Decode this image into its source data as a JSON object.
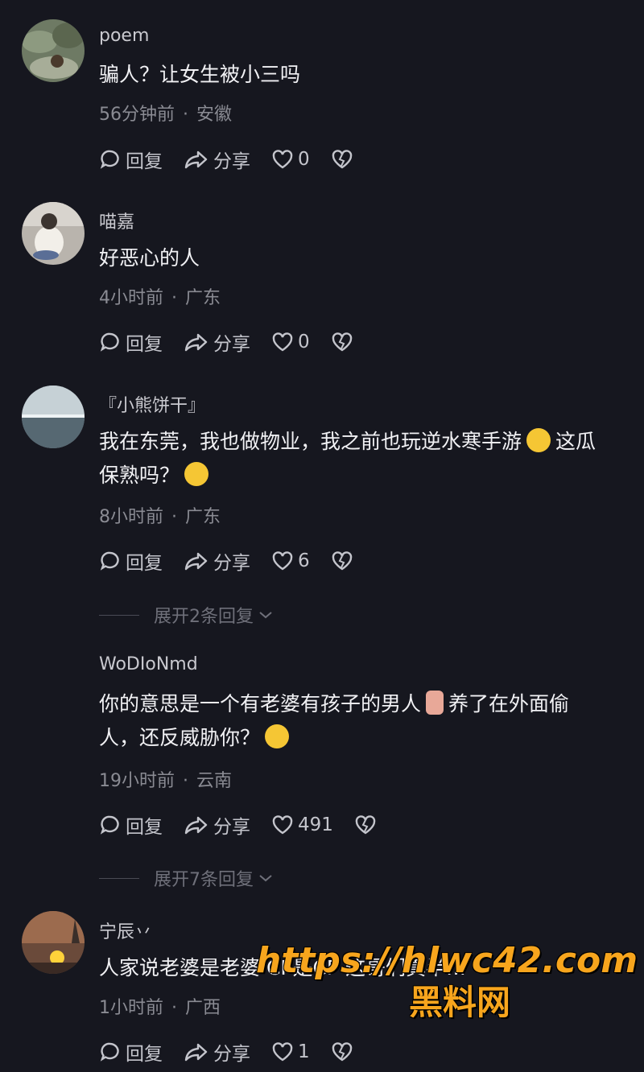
{
  "comments": [
    {
      "username": "poem",
      "lines": [
        "骗人？让女生被小三吗"
      ],
      "time": "56分钟前",
      "location": "安徽",
      "reply_label": "回复",
      "share_label": "分享",
      "likes": "0",
      "avatar_icon": "avatar-plant-icon"
    },
    {
      "username": "喵嘉",
      "lines": [
        "好恶心的人"
      ],
      "time": "4小时前",
      "location": "广东",
      "reply_label": "回复",
      "share_label": "分享",
      "likes": "0",
      "avatar_icon": "avatar-figure-icon"
    },
    {
      "username": "『小熊饼干』",
      "lines": [
        "我在东莞，我也做物业，我之前也玩逆水寒手游",
        "这瓜",
        "保熟吗？"
      ],
      "time": "8小时前",
      "location": "广东",
      "reply_label": "回复",
      "share_label": "分享",
      "likes": "6",
      "expand_label": "展开2条回复",
      "avatar_icon": "avatar-sea-icon"
    },
    {
      "username": "WoDIoNmd",
      "lines": [
        "你的意思是一个有老婆有孩子的男人",
        "养了在外面偷",
        "人，还反威胁你？"
      ],
      "time": "19小时前",
      "location": "云南",
      "reply_label": "回复",
      "share_label": "分享",
      "likes": "491",
      "expand_label": "展开7条回复"
    },
    {
      "username": "宁辰丷",
      "lines": [
        "人家说老婆是老婆 CP是CP 这哥们真半…"
      ],
      "time": "1小时前",
      "location": "广西",
      "reply_label": "回复",
      "share_label": "分享",
      "likes": "1",
      "avatar_icon": "avatar-sunset-icon"
    }
  ],
  "watermark": {
    "url": "https://hlwc42.com",
    "name": "黑料网"
  },
  "colors": {
    "background": "#16171f",
    "text": "#f1f1f4",
    "meta": "#8a8b93",
    "watermark": "#f7a51d"
  }
}
